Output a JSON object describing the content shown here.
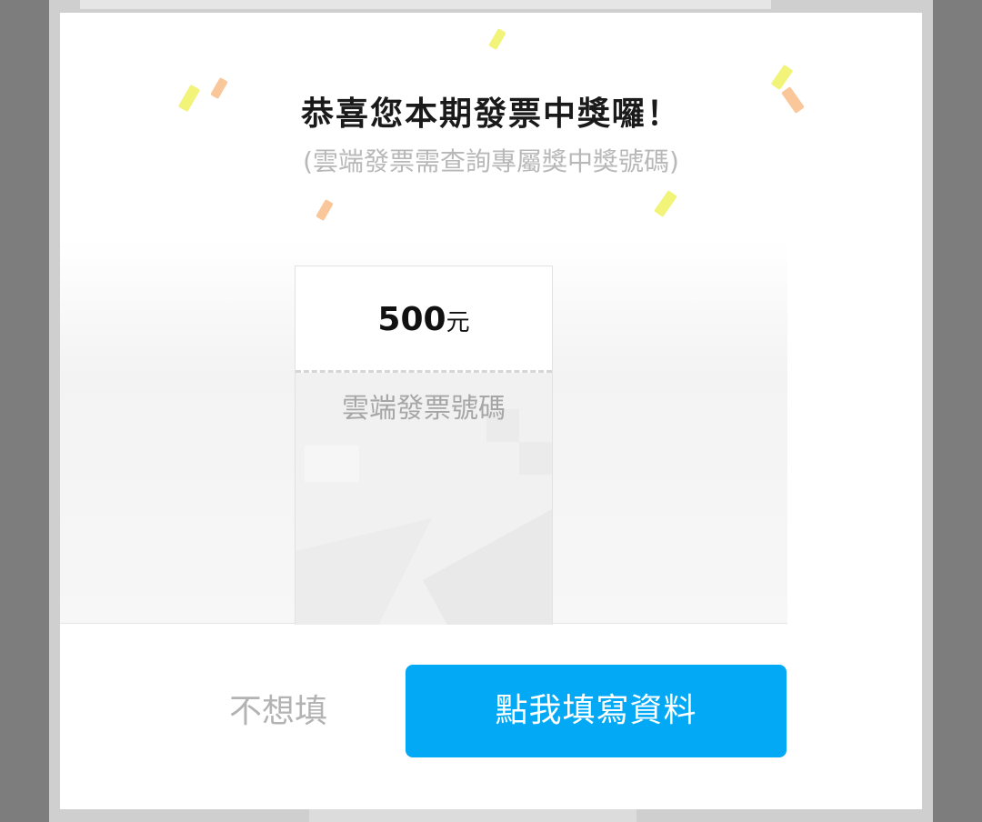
{
  "dialog": {
    "title": "恭喜您本期發票中獎囉！",
    "subtitle": "(雲端發票需查詢專屬獎中獎號碼)"
  },
  "ticket": {
    "amount": "500",
    "unit": "元",
    "label": "雲端發票號碼"
  },
  "actions": {
    "skip_label": "不想填",
    "fill_label": "點我填寫資料"
  },
  "colors": {
    "primary_button": "#03a9f4",
    "confetti_yellow": "#f2f47a",
    "confetti_orange": "#f9c79a"
  }
}
